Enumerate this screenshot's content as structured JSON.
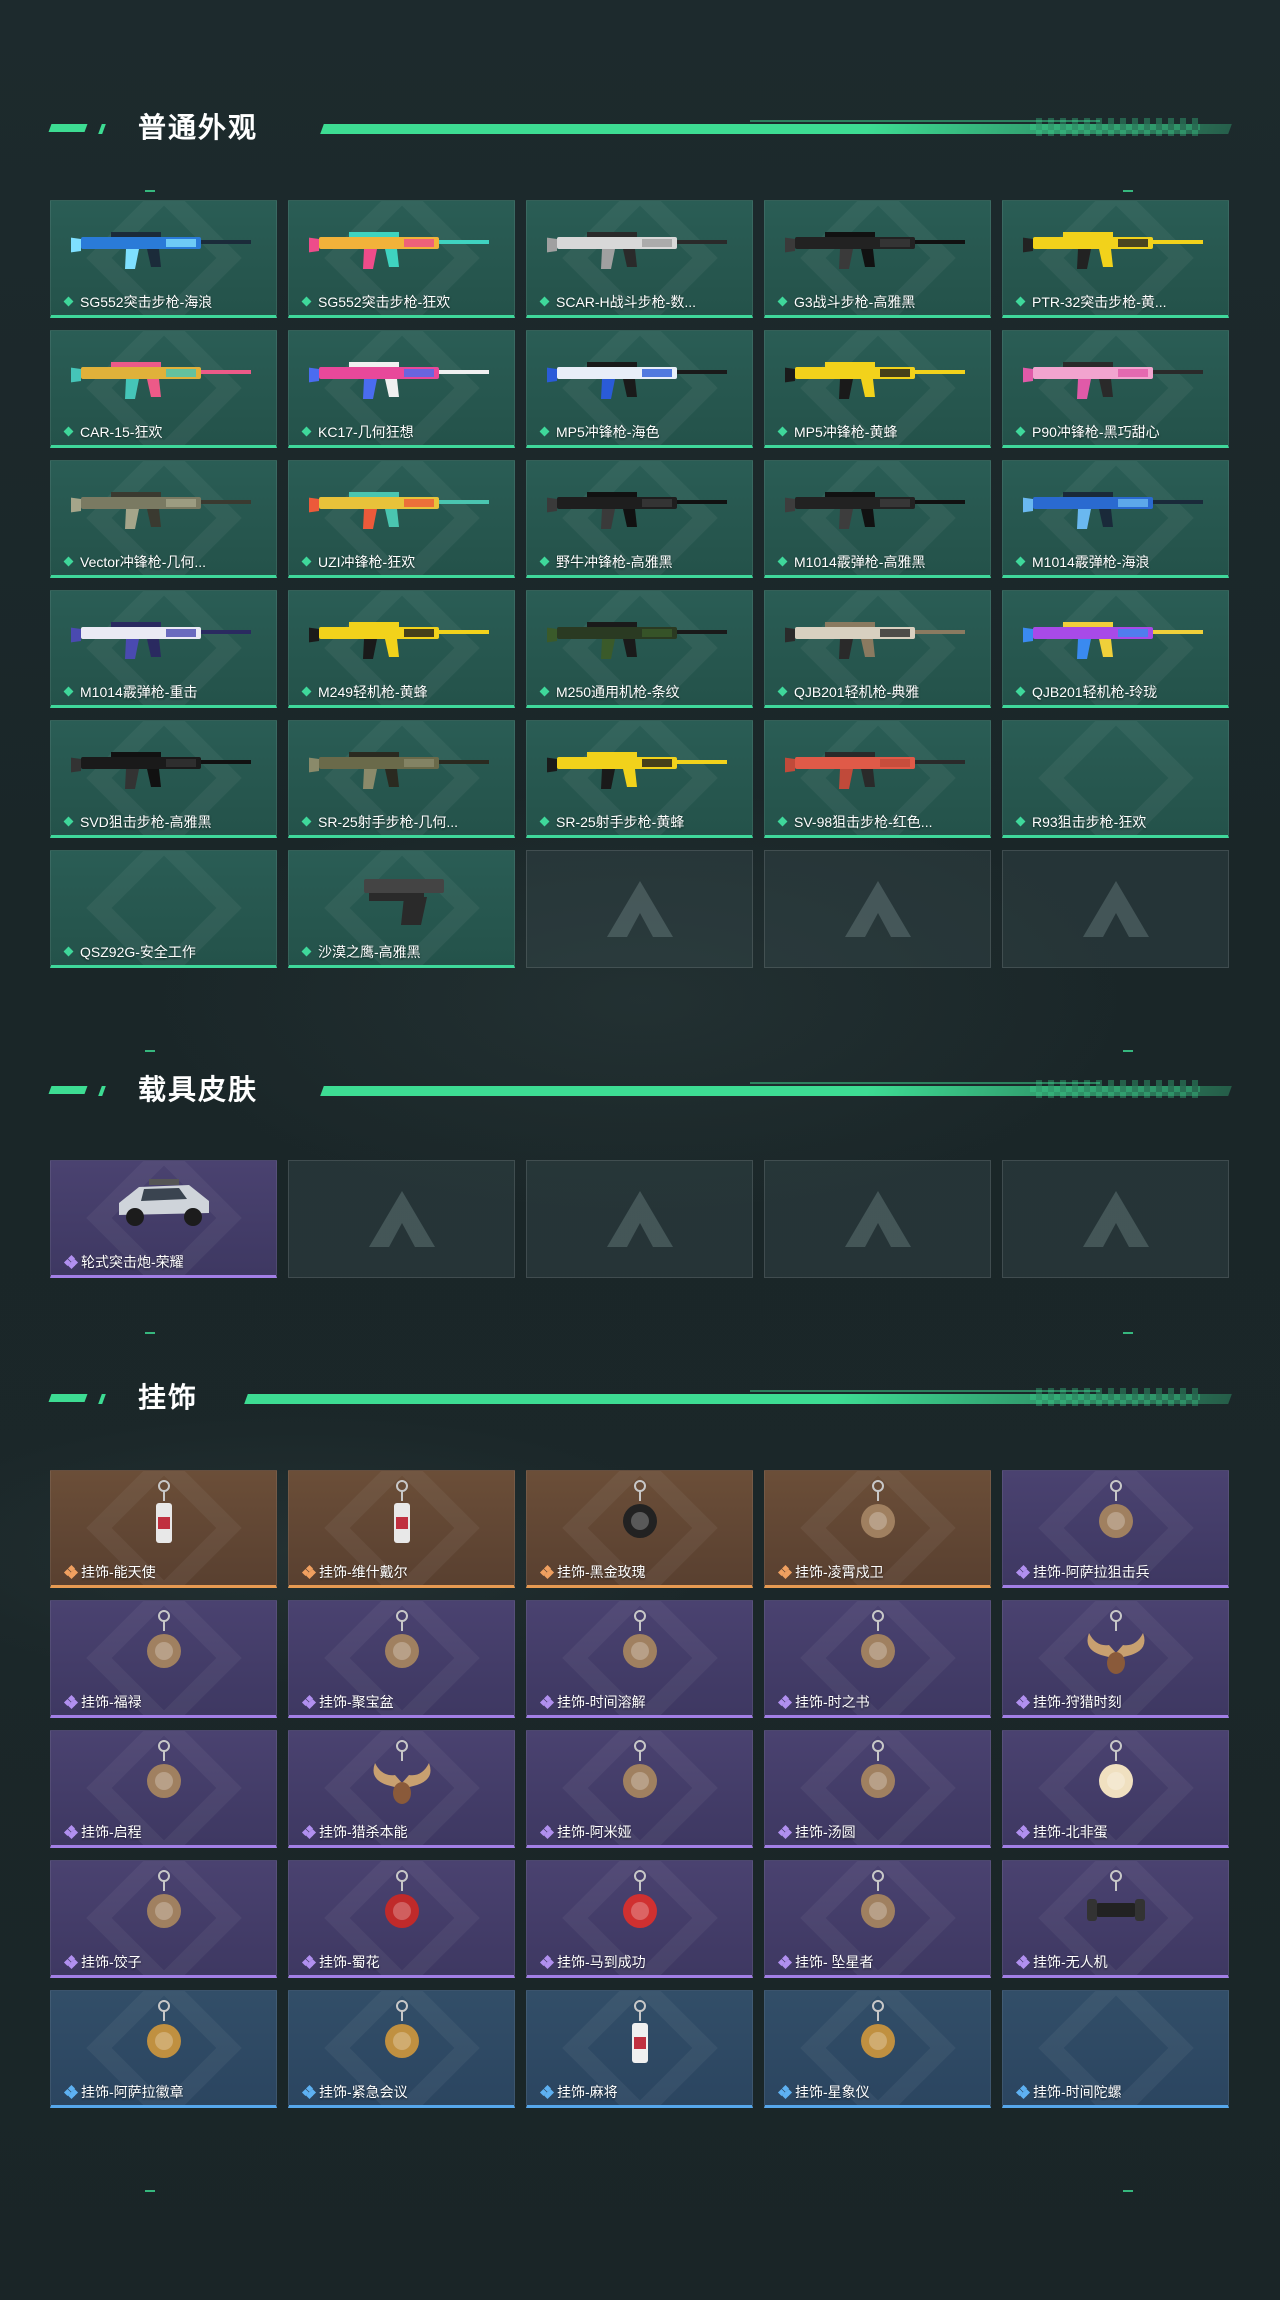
{
  "sections": {
    "weapons": {
      "title": "普通外观"
    },
    "vehicles": {
      "title": "载具皮肤"
    },
    "charms": {
      "title": "挂饰"
    }
  },
  "weapons": [
    {
      "label": "SG552突击步枪-海浪",
      "colors": [
        "#2a7bd8",
        "#7fe0ff",
        "#1b2b3a"
      ]
    },
    {
      "label": "SG552突击步枪-狂欢",
      "colors": [
        "#f2b23a",
        "#ee4c8a",
        "#3fd3c0"
      ]
    },
    {
      "label": "SCAR-H战斗步枪-数...",
      "colors": [
        "#d8d8d8",
        "#a0a0a0",
        "#2a2a2a"
      ]
    },
    {
      "label": "G3战斗步枪-高雅黑",
      "colors": [
        "#222222",
        "#3a3a3a",
        "#111111"
      ]
    },
    {
      "label": "PTR-32突击步枪-黄...",
      "colors": [
        "#f2d21b",
        "#222222",
        "#f2d21b"
      ]
    },
    {
      "label": "CAR-15-狂欢",
      "colors": [
        "#e0b13a",
        "#45c5b8",
        "#ec5a88"
      ]
    },
    {
      "label": "KC17-几何狂想",
      "colors": [
        "#e8489a",
        "#4a6cf0",
        "#f0f0f0"
      ]
    },
    {
      "label": "MP5冲锋枪-海色",
      "colors": [
        "#e8eef8",
        "#2a5bd8",
        "#1a1a1a"
      ]
    },
    {
      "label": "MP5冲锋枪-黄蜂",
      "colors": [
        "#f2d21b",
        "#1a1a1a",
        "#f2d21b"
      ]
    },
    {
      "label": "P90冲锋枪-黑巧甜心",
      "colors": [
        "#f2a4cf",
        "#e05aa8",
        "#2a2a2a"
      ]
    },
    {
      "label": "Vector冲锋枪-几何...",
      "colors": [
        "#7a7a62",
        "#a5a58a",
        "#3a3a30"
      ]
    },
    {
      "label": "UZI冲锋枪-狂欢",
      "colors": [
        "#e8c23a",
        "#ec5a3a",
        "#4ac5b0"
      ]
    },
    {
      "label": "野牛冲锋枪-高雅黑",
      "colors": [
        "#1e1e1e",
        "#3a3a3a",
        "#111111"
      ]
    },
    {
      "label": "M1014霰弹枪-高雅黑",
      "colors": [
        "#222222",
        "#3d3d3d",
        "#111111"
      ]
    },
    {
      "label": "M1014霰弹枪-海浪",
      "colors": [
        "#2a6ad0",
        "#6ab8f0",
        "#1a2a3a"
      ]
    },
    {
      "label": "M1014霰弹枪-重击",
      "colors": [
        "#eaeaf4",
        "#4a4ab0",
        "#2a2a60"
      ]
    },
    {
      "label": "M249轻机枪-黄蜂",
      "colors": [
        "#f2d21b",
        "#1a1a1a",
        "#f2d21b"
      ]
    },
    {
      "label": "M250通用机枪-条纹",
      "colors": [
        "#2a3a22",
        "#3a5a2a",
        "#1a1a1a"
      ]
    },
    {
      "label": "QJB201轻机枪-典雅",
      "colors": [
        "#d8d0c0",
        "#2a2a2a",
        "#8a7a60"
      ]
    },
    {
      "label": "QJB201轻机枪-玲珑",
      "colors": [
        "#a84ae8",
        "#3a8af0",
        "#f0d03a"
      ]
    },
    {
      "label": "SVD狙击步枪-高雅黑",
      "colors": [
        "#1a1a1a",
        "#333333",
        "#111111"
      ]
    },
    {
      "label": "SR-25射手步枪-几何...",
      "colors": [
        "#6a6a4a",
        "#8a8a6a",
        "#2a2a20"
      ]
    },
    {
      "label": "SR-25射手步枪-黄蜂",
      "colors": [
        "#f2d21b",
        "#1a1a1a",
        "#f2d21b"
      ]
    },
    {
      "label": "SV-98狙击步枪-红色...",
      "colors": [
        "#e05a48",
        "#c04a3a",
        "#2a2a2a"
      ]
    },
    {
      "label": "R93狙击步枪-狂欢",
      "colors": []
    },
    {
      "label": "QSZ92G-安全工作",
      "colors": []
    },
    {
      "label": "沙漠之鹰-高雅黑",
      "colors": [
        "#2a2a2a",
        "#444444",
        "#111111"
      ]
    }
  ],
  "vehicles": [
    {
      "label": "轮式突击炮-荣耀"
    }
  ],
  "charms": [
    {
      "label": "挂饰-能天使",
      "rarity": "orange",
      "icon": "bottle-icon"
    },
    {
      "label": "挂饰-维什戴尔",
      "rarity": "orange",
      "icon": "bottle-icon"
    },
    {
      "label": "挂饰-黑金玫瑰",
      "rarity": "orange",
      "icon": "rose-icon"
    },
    {
      "label": "挂饰-凌霄戍卫",
      "rarity": "orange",
      "icon": "bird-icon"
    },
    {
      "label": "挂饰-阿萨拉狙击兵",
      "rarity": "purple",
      "icon": "soldier-icon"
    },
    {
      "label": "挂饰-福禄",
      "rarity": "purple",
      "icon": "gourd-icon"
    },
    {
      "label": "挂饰-聚宝盆",
      "rarity": "purple",
      "icon": "treasure-bowl-icon"
    },
    {
      "label": "挂饰-时间溶解",
      "rarity": "purple",
      "icon": "clock-icon"
    },
    {
      "label": "挂饰-时之书",
      "rarity": "purple",
      "icon": "book-icon"
    },
    {
      "label": "挂饰-狩猎时刻",
      "rarity": "purple",
      "icon": "antler-icon"
    },
    {
      "label": "挂饰-启程",
      "rarity": "purple",
      "icon": "compass-icon"
    },
    {
      "label": "挂饰-猎杀本能",
      "rarity": "purple",
      "icon": "antler-icon"
    },
    {
      "label": "挂饰-阿米娅",
      "rarity": "purple",
      "icon": "rabbit-icon"
    },
    {
      "label": "挂饰-汤圆",
      "rarity": "purple",
      "icon": "dumpling-icon"
    },
    {
      "label": "挂饰-北非蛋",
      "rarity": "purple",
      "icon": "egg-icon"
    },
    {
      "label": "挂饰-饺子",
      "rarity": "purple",
      "icon": "dumpling-icon"
    },
    {
      "label": "挂饰-蜀花",
      "rarity": "purple",
      "icon": "flower-icon"
    },
    {
      "label": "挂饰-马到成功",
      "rarity": "purple",
      "icon": "horse-icon"
    },
    {
      "label": "挂饰- 坠星者",
      "rarity": "purple",
      "icon": "star-icon"
    },
    {
      "label": "挂饰-无人机",
      "rarity": "purple",
      "icon": "drone-icon"
    },
    {
      "label": "挂饰-阿萨拉徽章",
      "rarity": "blue",
      "icon": "badge-icon"
    },
    {
      "label": "挂饰-紧急会议",
      "rarity": "blue",
      "icon": "meeting-icon"
    },
    {
      "label": "挂饰-麻将",
      "rarity": "blue",
      "icon": "mahjong-icon"
    },
    {
      "label": "挂饰-星象仪",
      "rarity": "blue",
      "icon": "astrolabe-icon"
    },
    {
      "label": "挂饰-时间陀螺",
      "rarity": "blue",
      "icon": ""
    }
  ]
}
